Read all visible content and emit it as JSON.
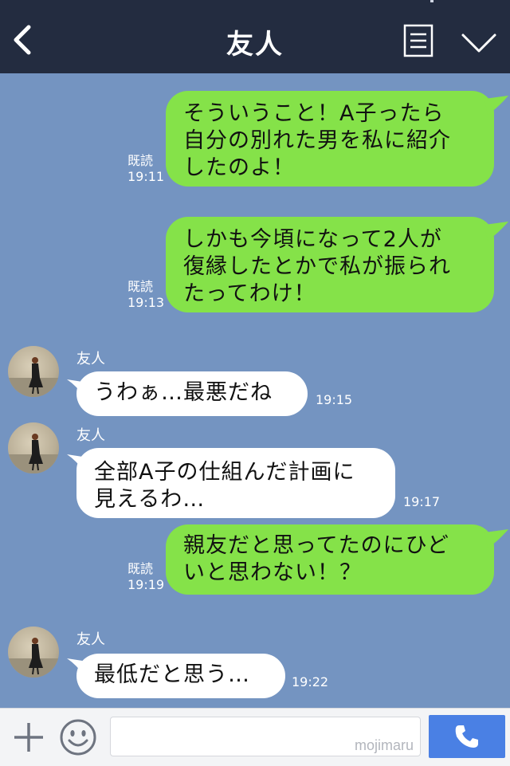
{
  "header": {
    "title": "友人",
    "back_icon": "chevron-left-icon",
    "menu_icon": "document-menu-icon",
    "expand_icon": "chevron-down-icon"
  },
  "colors": {
    "header_bg": "#232c40",
    "chat_bg": "#7494c1",
    "outgoing_bubble": "#85e249",
    "incoming_bubble": "#ffffff",
    "call_button": "#4a80e4"
  },
  "messages": [
    {
      "direction": "out",
      "lines": [
        "そういうこと！A子ったら",
        "自分の別れた男を私に紹介",
        "したのよ！"
      ],
      "read_label": "既読",
      "time": "19:11"
    },
    {
      "direction": "out",
      "lines": [
        "しかも今頃になって2人が",
        "復縁したとかで私が振られ",
        "たってわけ！"
      ],
      "read_label": "既読",
      "time": "19:13"
    },
    {
      "direction": "in",
      "sender": "友人",
      "lines": [
        "うわぁ…最悪だね"
      ],
      "time": "19:15"
    },
    {
      "direction": "in",
      "sender": "友人",
      "lines": [
        "全部A子の仕組んだ計画に",
        "見えるわ…"
      ],
      "time": "19:17"
    },
    {
      "direction": "out",
      "lines": [
        "親友だと思ってたのにひど",
        "いと思わない！？"
      ],
      "read_label": "既読",
      "time": "19:19"
    },
    {
      "direction": "in",
      "sender": "友人",
      "lines": [
        "最低だと思う…"
      ],
      "time": "19:22"
    }
  ],
  "input_bar": {
    "plus_icon": "plus-icon",
    "emoji_icon": "smiley-icon",
    "input_value": "",
    "watermark": "mojimaru",
    "call_icon": "phone-icon"
  }
}
